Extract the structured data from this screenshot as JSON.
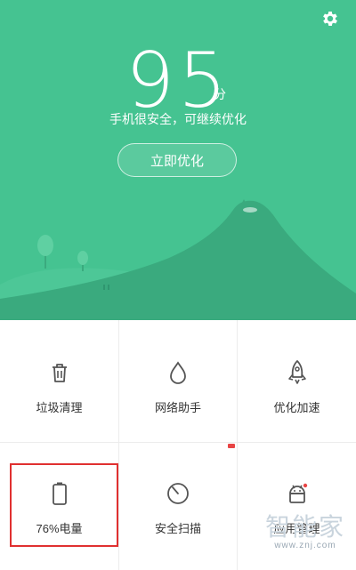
{
  "header": {
    "score": "95",
    "score_unit": "分",
    "status": "手机很安全，可继续优化",
    "optimize_button": "立即优化",
    "settings_icon": "gear-icon"
  },
  "tools": [
    {
      "label": "垃圾清理",
      "icon": "trash-icon"
    },
    {
      "label": "网络助手",
      "icon": "droplet-icon"
    },
    {
      "label": "优化加速",
      "icon": "rocket-icon"
    },
    {
      "label": "76%电量",
      "icon": "battery-icon"
    },
    {
      "label": "安全扫描",
      "icon": "radar-scan-icon"
    },
    {
      "label": "应用管理",
      "icon": "android-icon"
    }
  ],
  "watermark": {
    "title": "智能家",
    "url": "www.znj.com"
  },
  "colors": {
    "primary": "#45c391",
    "hill_dark": "#3aaa7e",
    "highlight": "#e03030"
  }
}
